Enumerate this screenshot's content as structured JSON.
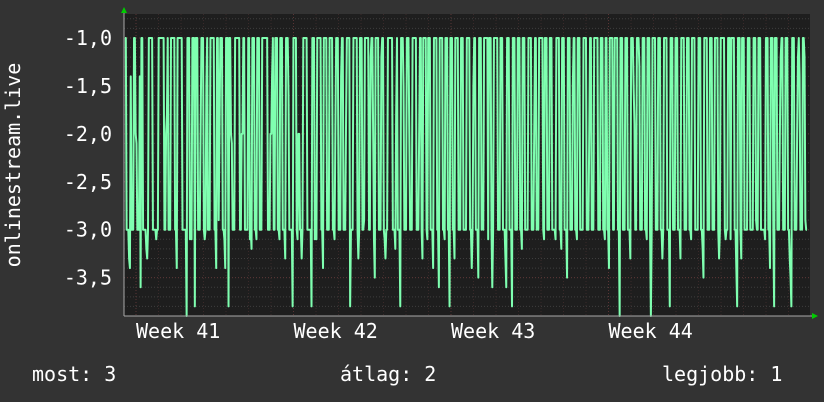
{
  "chart_data": {
    "type": "line",
    "ylabel": "onlinestream.live",
    "yticks": [
      -1.0,
      -1.5,
      -2.0,
      -2.5,
      -3.0,
      -3.5
    ],
    "ytick_labels": [
      "-1,0",
      "-1,5",
      "-2,0",
      "-2,5",
      "-3,0",
      "-3,5"
    ],
    "ylim": [
      -3.9,
      -0.75
    ],
    "xticks": [
      "Week 41",
      "Week 42",
      "Week 43",
      "Week 44"
    ],
    "grid": true,
    "series_color": "#7fffb0",
    "series": [
      {
        "values": [
          -1,
          -1,
          -3,
          -3,
          -3,
          -3.3,
          -3.4,
          -1.4,
          -3,
          -3,
          -3,
          -1,
          -1,
          -2,
          -2.1,
          -3,
          -3,
          -3,
          -1.4,
          -3.6,
          -1,
          -1,
          -3,
          -3,
          -3,
          -3,
          -3.2,
          -3.3,
          -3,
          -1,
          -1,
          -1,
          -1,
          -1,
          -3,
          -3,
          -3,
          -3,
          -3.1,
          -3,
          -3,
          -1,
          -1,
          -1,
          -1,
          -1,
          -1,
          -1,
          -3,
          -3,
          -2,
          -1.8,
          -1,
          -3,
          -3,
          -3,
          -1,
          -1,
          -1,
          -1,
          -1,
          -3,
          -3,
          -3.4,
          -1,
          -1,
          -1,
          -1,
          -1,
          -1,
          -3,
          -3,
          -3,
          -3,
          -3,
          -3.9,
          -1,
          -1,
          -1,
          -3.1,
          -3,
          -3.1,
          -1,
          -1,
          -1,
          -3.8,
          -1,
          -1,
          -1,
          -3,
          -3,
          -3,
          -2,
          -1,
          -1,
          -1,
          -3,
          -3.1,
          -3,
          -1.5,
          -1,
          -3,
          -3,
          -3,
          -1,
          -1,
          -1,
          -1,
          -1,
          -3,
          -3,
          -3.4,
          -1,
          -1,
          -2.9,
          -2,
          -1,
          -1,
          -1,
          -3,
          -3,
          -3.1,
          -3.4,
          -1,
          -1,
          -1,
          -3.8,
          -1,
          -1,
          -2,
          -2.1,
          -3,
          -3,
          -3,
          -1,
          -1,
          -1,
          -1,
          -1,
          -1,
          -3,
          -3,
          -2,
          -2,
          -1,
          -1,
          -3,
          -3,
          -3,
          -3,
          -1,
          -1,
          -3.1,
          -3,
          -3.2,
          -1,
          -1,
          -1,
          -3,
          -3,
          -3.1,
          -1,
          -1,
          -1,
          -3,
          -3,
          -3,
          -1,
          -1,
          -1,
          -1,
          -1,
          -1,
          -1,
          -3,
          -3,
          -3,
          -2,
          -2,
          -1.4,
          -1,
          -3,
          -3,
          -1,
          -1,
          -1,
          -3,
          -3,
          -3.1,
          -1,
          -1,
          -1,
          -3,
          -3,
          -3,
          -3.3,
          -1,
          -1,
          -1,
          -1.6,
          -3,
          -3,
          -3,
          -3,
          -3.8,
          -1,
          -1,
          -1,
          -1,
          -3,
          -3.1,
          -2,
          -2,
          -3,
          -3,
          -3.3,
          -3,
          -1,
          -1,
          -1,
          -1,
          -1,
          -3,
          -3,
          -3,
          -3,
          -3,
          -3.8,
          -1,
          -1,
          -1,
          -3.1,
          -3,
          -3.1,
          -1,
          -1,
          -1,
          -1,
          -1,
          -3,
          -3,
          -3.4,
          -1,
          -1,
          -1,
          -1,
          -3,
          -3,
          -3,
          -1,
          -1,
          -1,
          -1,
          -3,
          -3,
          -3.1,
          -2,
          -1,
          -1,
          -1,
          -3,
          -3,
          -3,
          -1.4,
          -1,
          -1,
          -3,
          -3,
          -3,
          -1.9,
          -1,
          -1,
          -1,
          -1,
          -3.8,
          -3,
          -3,
          -3,
          -1,
          -1,
          -1,
          -1,
          -1,
          -3,
          -3.3,
          -3,
          -1,
          -1,
          -1,
          -3,
          -3,
          -2.9,
          -1,
          -1,
          -1,
          -1,
          -1,
          -3,
          -3,
          -1.2,
          -1,
          -1,
          -2,
          -3.1,
          -3.5,
          -1,
          -1,
          -1,
          -1,
          -3,
          -3,
          -3,
          -1.2,
          -1,
          -1,
          -3,
          -3.1,
          -3.3,
          -3,
          -3,
          -1,
          -1,
          -1,
          -1,
          -1,
          -1,
          -3,
          -3,
          -3,
          -3.2,
          -1.8,
          -1,
          -3,
          -3,
          -3,
          -3.8,
          -1,
          -1,
          -1,
          -1.5,
          -3,
          -3,
          -3,
          -1,
          -1,
          -1,
          -2,
          -3,
          -3,
          -3,
          -1,
          -1,
          -1,
          -1,
          -1,
          -3,
          -3,
          -3,
          -2,
          -1,
          -1,
          -3,
          -3.3,
          -1,
          -1,
          -1,
          -1,
          -3,
          -3.1,
          -1,
          -1,
          -1,
          -3,
          -3,
          -3,
          -3.4,
          -1,
          -1,
          -1,
          -1,
          -3,
          -3,
          -3.6,
          -1,
          -1,
          -1,
          -1,
          -3,
          -3,
          -3.1,
          -1,
          -1,
          -1,
          -3,
          -3,
          -3.8,
          -1,
          -1,
          -1,
          -3,
          -3,
          -3.3,
          -1,
          -1,
          -1,
          -1,
          -3,
          -3,
          -3,
          -1,
          -1,
          -1,
          -3,
          -3,
          -3,
          -3,
          -1,
          -1,
          -1,
          -1,
          -3,
          -3,
          -3.4,
          -3,
          -1.5,
          -1,
          -1,
          -3,
          -3,
          -3,
          -3.5,
          -1,
          -1,
          -1,
          -3,
          -2.9,
          -3,
          -1,
          -1,
          -1,
          -1,
          -1,
          -3.1,
          -1,
          -1,
          -1,
          -3,
          -3.6,
          -3,
          -1,
          -1,
          -1,
          -1,
          -1,
          -3,
          -3,
          -3,
          -1,
          -1,
          -1,
          -3,
          -3,
          -3,
          -3.3,
          -3.6,
          -1,
          -1,
          -1,
          -3,
          -3,
          -3,
          -3.8,
          -1,
          -1,
          -1,
          -3,
          -3,
          -3,
          -1,
          -1,
          -1,
          -3,
          -3,
          -3.2,
          -1,
          -1,
          -1,
          -3,
          -3,
          -3,
          -3,
          -1,
          -1,
          -1,
          -1,
          -3,
          -3,
          -3,
          -2,
          -1,
          -1,
          -3,
          -2.9,
          -3,
          -1,
          -1,
          -1,
          -1,
          -1,
          -3,
          -3.1,
          -1,
          -1,
          -1,
          -3,
          -3,
          -3,
          -1,
          -1,
          -1,
          -3,
          -3,
          -3,
          -3,
          -3.1,
          -1,
          -1,
          -1,
          -1,
          -3,
          -3,
          -3.2,
          -1,
          -1,
          -1,
          -3,
          -3,
          -3,
          -3.5,
          -1,
          -1,
          -1,
          -3,
          -3,
          -3,
          -1.5,
          -1,
          -1,
          -3,
          -3,
          -3.1,
          -1,
          -1,
          -1,
          -3,
          -3,
          -3,
          -3,
          -1,
          -1,
          -1,
          -1,
          -3,
          -3,
          -3,
          -2,
          -1,
          -1,
          -3,
          -3,
          -3,
          -1,
          -1,
          -1,
          -1,
          -1,
          -3,
          -3,
          -3,
          -1,
          -1,
          -1,
          -3,
          -3,
          -3.1,
          -1,
          -1,
          -3,
          -3,
          -3.4,
          -1,
          -1,
          -1,
          -1,
          -3,
          -3,
          -1,
          -1,
          -1,
          -1,
          -3,
          -3,
          -3.9,
          -1,
          -1,
          -1,
          -3,
          -3,
          -3,
          -1,
          -1,
          -1,
          -3,
          -3,
          -3,
          -3.3,
          -1,
          -1,
          -1,
          -1.5,
          -1.9,
          -3,
          -3,
          -1,
          -1,
          -1,
          -1.3,
          -3,
          -3,
          -3,
          -1,
          -1,
          -1,
          -3,
          -3,
          -3.1,
          -1,
          -1,
          -1,
          -3,
          -3.9,
          -3,
          -1,
          -1,
          -1,
          -1,
          -3,
          -3,
          -3,
          -1,
          -1,
          -1,
          -3,
          -3,
          -3.3,
          -3,
          -1,
          -1,
          -1,
          -1,
          -3,
          -3,
          -3,
          -3.8,
          -1,
          -1,
          -1,
          -3,
          -3,
          -3,
          -1,
          -1,
          -1,
          -3,
          -3,
          -3,
          -3.3,
          -1,
          -1,
          -1,
          -1,
          -3,
          -3,
          -3,
          -1,
          -1,
          -1,
          -3,
          -3,
          -3.1,
          -1,
          -1,
          -1,
          -1,
          -3,
          -3,
          -3,
          -3,
          -1,
          -1,
          -1,
          -3,
          -3,
          -3.2,
          -3.5,
          -1,
          -1,
          -1,
          -1,
          -3,
          -3,
          -3,
          -1,
          -1,
          -1,
          -3,
          -3,
          -3,
          -1,
          -1,
          -1,
          -1,
          -3,
          -3.3,
          -3,
          -1,
          -1,
          -1,
          -1,
          -1,
          -3,
          -3.1,
          -3,
          -3,
          -1,
          -1,
          -1,
          -3.1,
          -1,
          -1,
          -1,
          -1,
          -3,
          -3,
          -3.4,
          -3.8,
          -1,
          -1,
          -1,
          -3,
          -3.3,
          -1,
          -1,
          -1,
          -3,
          -3,
          -3,
          -3,
          -1,
          -1,
          -1,
          -3,
          -3,
          -3,
          -3,
          -1,
          -1,
          -1,
          -2.9,
          -3,
          -3,
          -1,
          -1,
          -1,
          -3,
          -3,
          -3,
          -3,
          -3,
          -3.1,
          -1,
          -1,
          -1,
          -3,
          -3,
          -3.4,
          -1,
          -1,
          -1,
          -3,
          -3.8,
          -1,
          -1,
          -1,
          -3,
          -3,
          -3,
          -2,
          -1.2,
          -1,
          -1,
          -3,
          -3,
          -3,
          -1,
          -1,
          -1,
          -3,
          -3,
          -3.3,
          -3.5,
          -3.8,
          -1,
          -1,
          -1,
          -3,
          -3,
          -3,
          -2,
          -1.2,
          -1,
          -1.4,
          -3,
          -2.9,
          -3,
          -1,
          -1,
          -1.2,
          -2.9,
          -3,
          -3
        ]
      }
    ]
  },
  "stats": {
    "now": "most: 3",
    "avg": "átlag: 2",
    "best": "legjobb: 1"
  }
}
